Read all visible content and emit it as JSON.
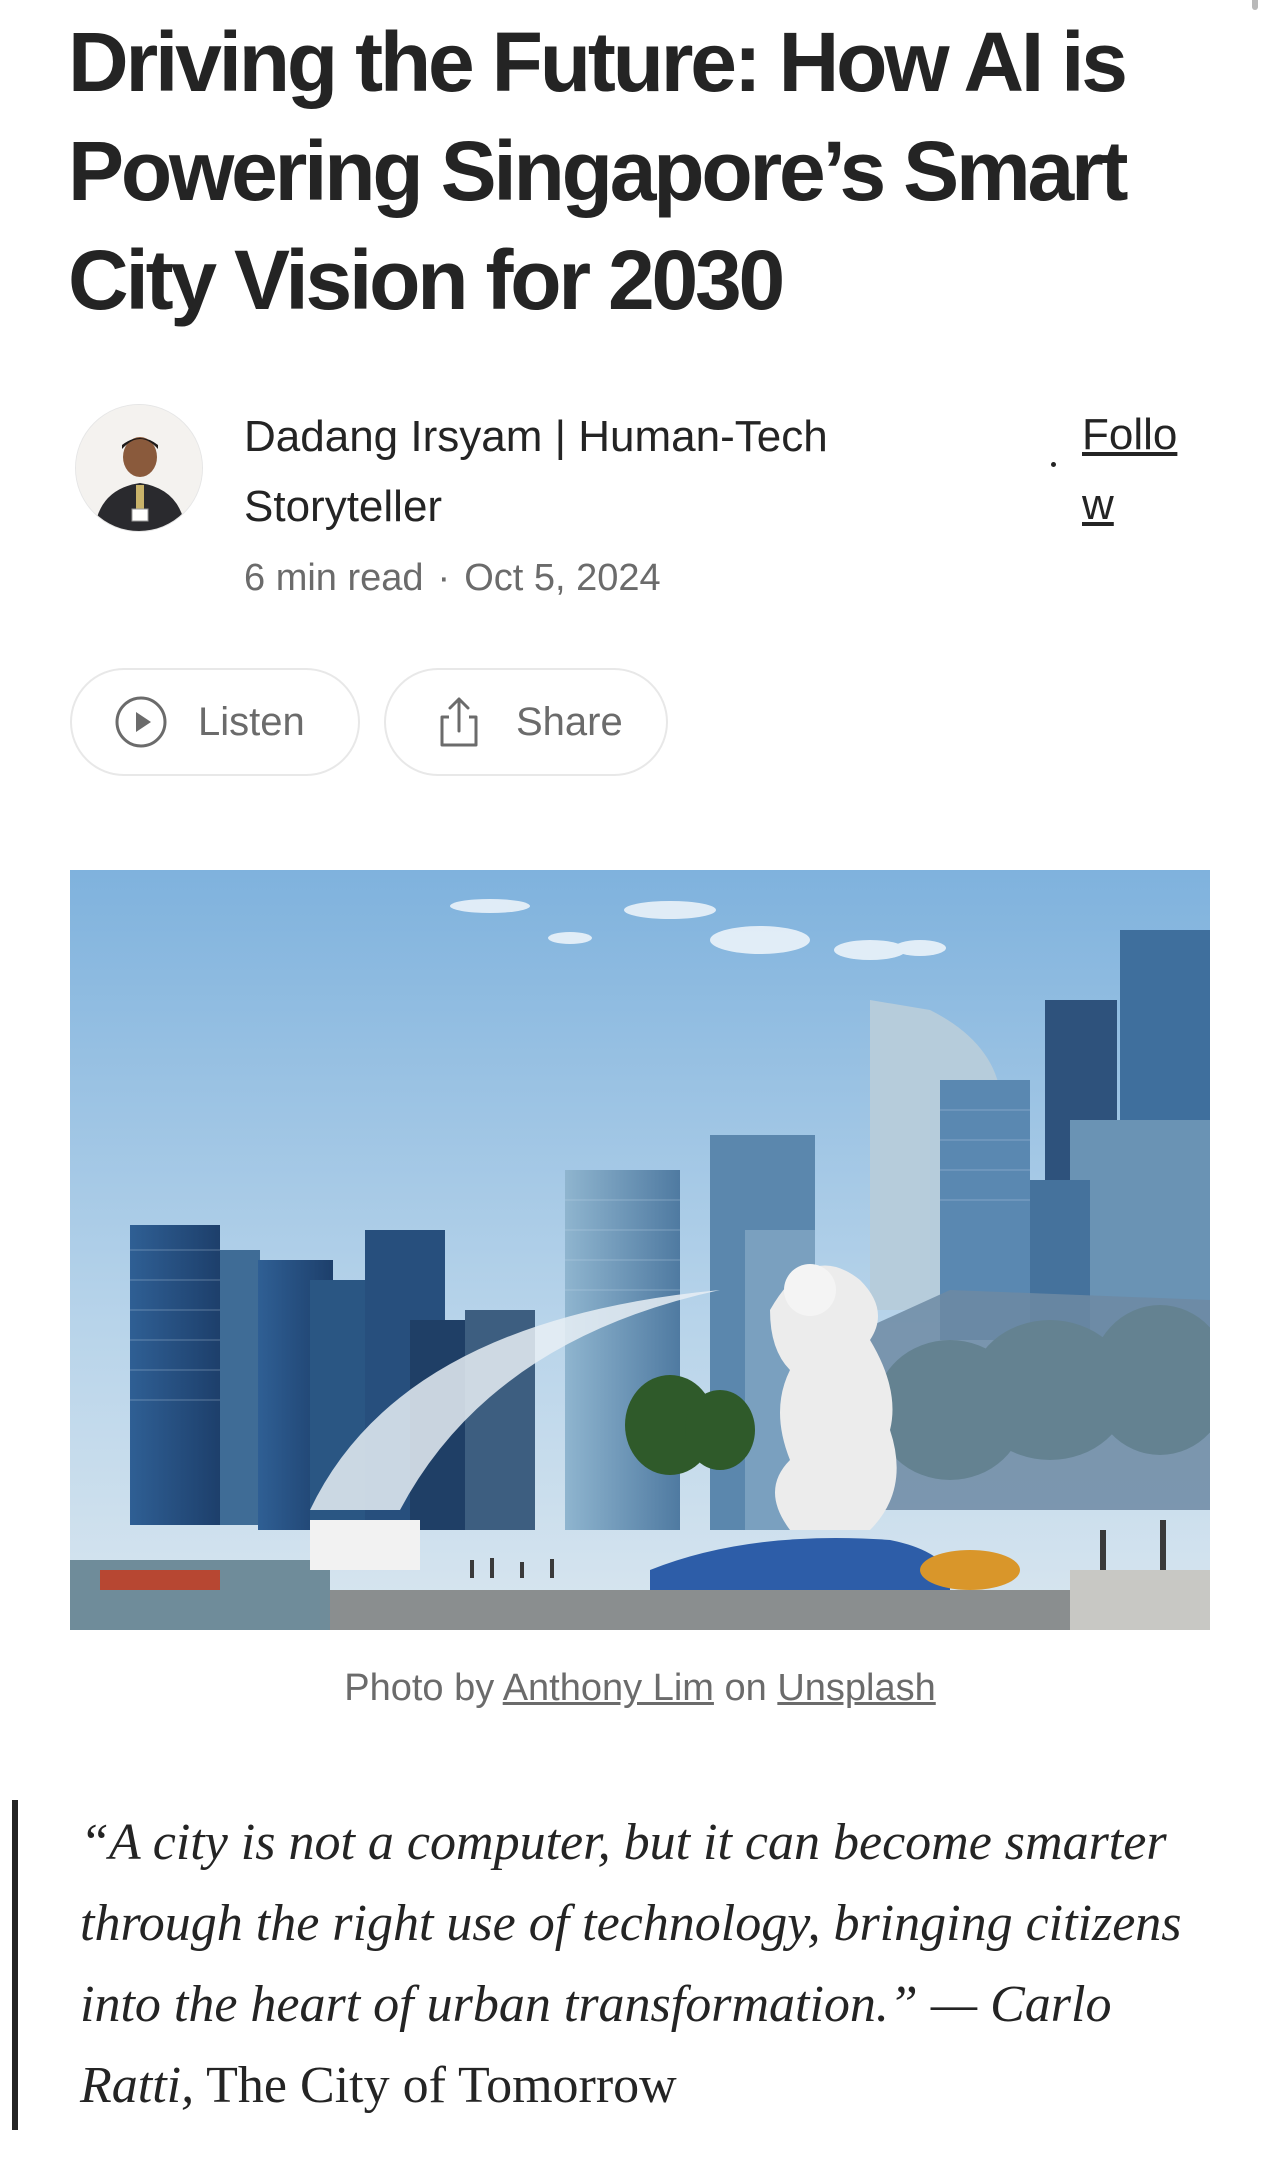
{
  "article": {
    "title": "Driving the Future: How AI is Powering Singapore’s Smart City Vision for 2030",
    "author": "Dadang Irsyam | Human-Tech Storyteller",
    "read_time": "6 min read",
    "separator": "·",
    "date": "Oct 5, 2024",
    "follow_label": "Follow"
  },
  "actions": {
    "listen_label": "Listen",
    "listen_icon": "play-circle-icon",
    "share_label": "Share",
    "share_icon": "share-icon"
  },
  "hero_image": {
    "description_icon": "photo-merlion-singapore-skyline",
    "caption_prefix": "Photo by",
    "caption_author": "Anthony Lim",
    "caption_middle": "on",
    "caption_source": "Unsplash"
  },
  "quote": {
    "text": "“A city is not a computer, but it can become smarter through the right use of technology, bringing citizens into the heart of urban transformation.” — Carlo Ratti,",
    "book": "The City of Tomorrow"
  },
  "colors": {
    "text": "#242424",
    "muted": "#6b6b6b",
    "border": "#e8e8e8"
  }
}
